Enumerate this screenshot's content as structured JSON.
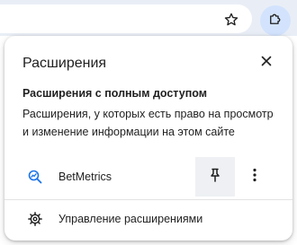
{
  "toolbar": {
    "star_icon": "bookmark-star-icon",
    "extensions_icon": "puzzle-piece-icon"
  },
  "panel": {
    "title": "Расширения",
    "close_icon": "close-icon",
    "full_access": {
      "heading": "Расширения с полным доступом",
      "description": "Расширения, у которых есть право на просмотр и изменение информации на этом сайте"
    },
    "extensions": [
      {
        "name": "BetMetrics",
        "icon": "magnifier-chart-icon",
        "pin_icon": "pin-icon",
        "more_icon": "more-vertical-icon"
      }
    ],
    "manage": {
      "label": "Управление расширениями",
      "icon": "gear-icon"
    }
  },
  "colors": {
    "toolbar_bg": "#e9eef6",
    "active_button_bg": "#d3e3fd",
    "pin_hover_bg": "#eef0f3",
    "ext_icon_blue": "#1a73e8",
    "text": "#1f1f1f"
  }
}
